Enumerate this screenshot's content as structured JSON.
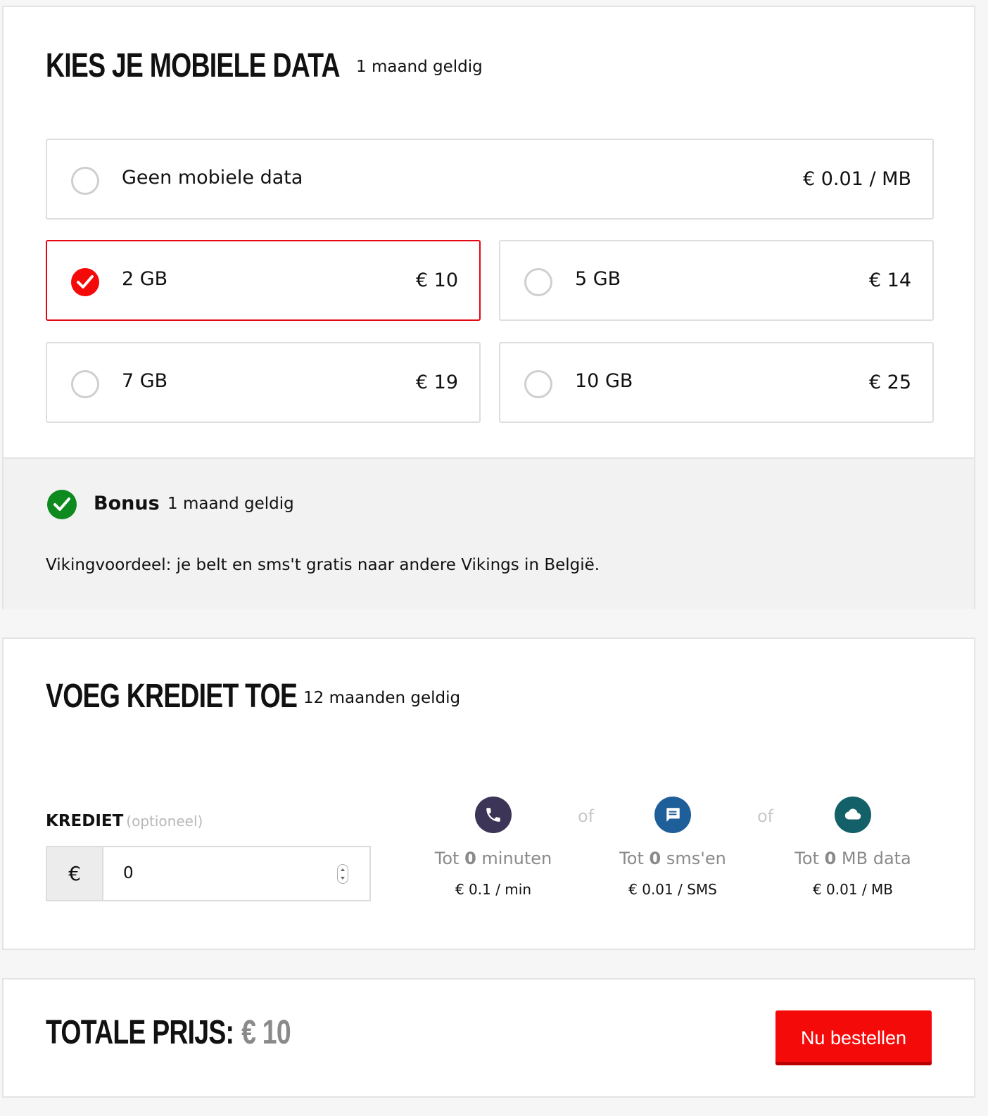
{
  "data_section": {
    "title": "KIES JE MOBIELE DATA",
    "validity": "1 maand geldig",
    "options": [
      {
        "label": "Geen mobiele data",
        "price": "€ 0.01 / MB",
        "selected": false
      },
      {
        "label": "2 GB",
        "price": "€ 10",
        "selected": true
      },
      {
        "label": "5 GB",
        "price": "€ 14",
        "selected": false
      },
      {
        "label": "7 GB",
        "price": "€ 19",
        "selected": false
      },
      {
        "label": "10 GB",
        "price": "€ 25",
        "selected": false
      }
    ],
    "bonus": {
      "label": "Bonus",
      "validity": "1 maand geldig",
      "text": "Vikingvoordeel: je belt en sms't gratis naar andere Vikings in België."
    }
  },
  "credit_section": {
    "title": "VOEG KREDIET TOE",
    "validity": "12 maanden geldig",
    "field_label": "KREDIET",
    "field_optional": "(optioneel)",
    "currency": "€",
    "value": "0",
    "separator": "of",
    "calculations": [
      {
        "prefix": "Tot",
        "amount": "0",
        "unit": "minuten",
        "rate": "€ 0.1 / min",
        "icon": "phone-icon",
        "color": "#3d3557"
      },
      {
        "prefix": "Tot",
        "amount": "0",
        "unit": "sms'en",
        "rate": "€ 0.01 / SMS",
        "icon": "message-icon",
        "color": "#1f5f99"
      },
      {
        "prefix": "Tot",
        "amount": "0",
        "unit": "MB data",
        "rate": "€ 0.01 / MB",
        "icon": "cloud-icon",
        "color": "#146068"
      }
    ]
  },
  "total_section": {
    "label": "TOTALE PRIJS:",
    "value": "€ 10",
    "button": "Nu bestellen"
  },
  "colors": {
    "accent": "#f50a0a",
    "bonus_green": "#0f8a1f"
  }
}
